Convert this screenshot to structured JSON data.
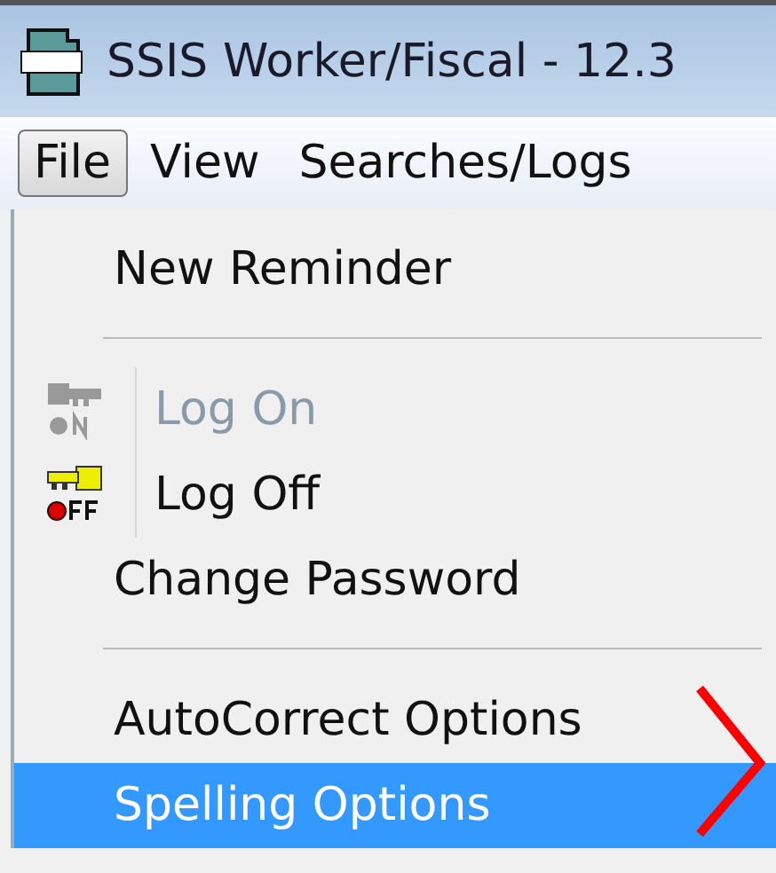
{
  "window": {
    "title": "SSIS Worker/Fiscal - 12.3"
  },
  "menu_bar": [
    {
      "label": "File",
      "selected": true
    },
    {
      "label": "View",
      "selected": false
    },
    {
      "label": "Searches/Logs",
      "selected": false
    }
  ],
  "file_menu": [
    {
      "kind": "item",
      "label": "New Reminder",
      "disabled": false,
      "selected": false
    },
    {
      "kind": "separator"
    },
    {
      "kind": "logon",
      "label": "Log On",
      "disabled": true,
      "selected": false
    },
    {
      "kind": "logoff",
      "label": "Log Off",
      "disabled": false,
      "selected": false
    },
    {
      "kind": "item",
      "label": "Change Password",
      "disabled": false,
      "selected": false
    },
    {
      "kind": "separator"
    },
    {
      "kind": "item",
      "label": "AutoCorrect Options",
      "disabled": false,
      "selected": false
    },
    {
      "kind": "item",
      "label": "Spelling Options",
      "disabled": false,
      "selected": true
    }
  ]
}
